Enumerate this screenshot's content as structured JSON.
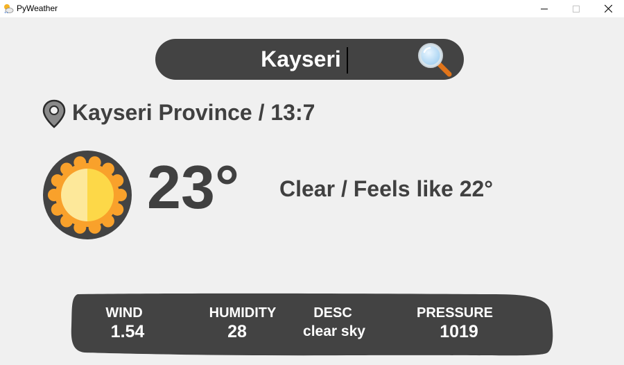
{
  "window": {
    "title": "PyWeather",
    "icon": "partly-cloudy-app-icon"
  },
  "search": {
    "value": "Kayseri",
    "icon": "magnifier-icon"
  },
  "location": {
    "icon": "map-pin-icon",
    "text": "Kayseri Province / 13:7"
  },
  "current": {
    "icon": "sun-icon",
    "temperature": "23°",
    "condition": "Clear / Feels like 22°"
  },
  "stats": {
    "wind": {
      "label": "WIND",
      "value": "1.54"
    },
    "humidity": {
      "label": "HUMIDITY",
      "value": "28"
    },
    "desc": {
      "label": "DESC",
      "value": "clear sky"
    },
    "pressure": {
      "label": "PRESSURE",
      "value": "1019"
    }
  },
  "colors": {
    "panel": "#434343",
    "background": "#f0f0f0",
    "text_dark": "#404040",
    "sun_outer": "#f9a12b",
    "sun_inner_left": "#fde89a",
    "sun_inner_right": "#fdd848"
  }
}
